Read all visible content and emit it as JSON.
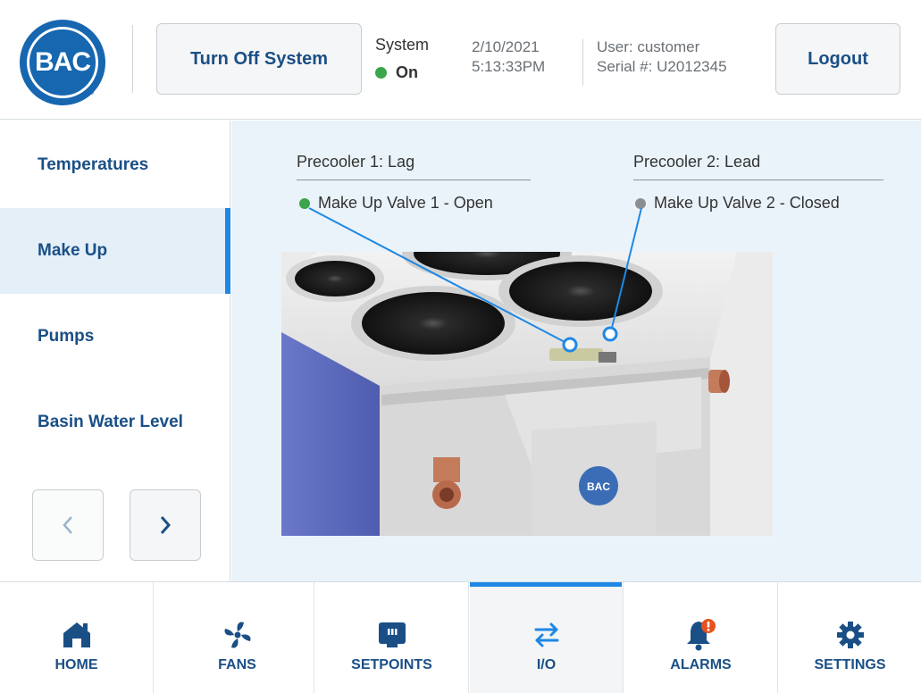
{
  "header": {
    "logo_text": "BAC",
    "logo_reg": "®",
    "turn_off_label": "Turn Off System",
    "system_label": "System",
    "system_state": "On",
    "date": "2/10/2021",
    "time": "5:13:33PM",
    "user": "User: customer",
    "serial": "Serial #: U2012345",
    "logout_label": "Logout"
  },
  "sidebar": {
    "items": [
      {
        "label": "Temperatures",
        "active": false
      },
      {
        "label": "Make Up",
        "active": true
      },
      {
        "label": "Pumps",
        "active": false
      },
      {
        "label": "Basin Water Level",
        "active": false
      }
    ]
  },
  "main": {
    "precooler1": {
      "title": "Precooler 1: Lag",
      "valve": "Make Up Valve 1 - Open",
      "status_color": "#3aa54a"
    },
    "precooler2": {
      "title": "Precooler 2: Lead",
      "valve": "Make Up Valve 2 - Closed",
      "status_color": "#8b8f93"
    },
    "image_badge": "BAC"
  },
  "nav": {
    "items": [
      {
        "label": "HOME",
        "icon": "home-icon"
      },
      {
        "label": "FANS",
        "icon": "fan-icon"
      },
      {
        "label": "SETPOINTS",
        "icon": "setpoints-icon"
      },
      {
        "label": "I/O",
        "icon": "io-arrows-icon",
        "active": true
      },
      {
        "label": "ALARMS",
        "icon": "bell-alert-icon",
        "badge": "!"
      },
      {
        "label": "SETTINGS",
        "icon": "gear-icon"
      }
    ]
  },
  "colors": {
    "brand_blue": "#1666b0",
    "accent_blue": "#1e88e5",
    "nav_text": "#1a4f86",
    "status_on": "#3aa54a",
    "status_off": "#8b8f93",
    "alarm_badge": "#e8501d"
  }
}
